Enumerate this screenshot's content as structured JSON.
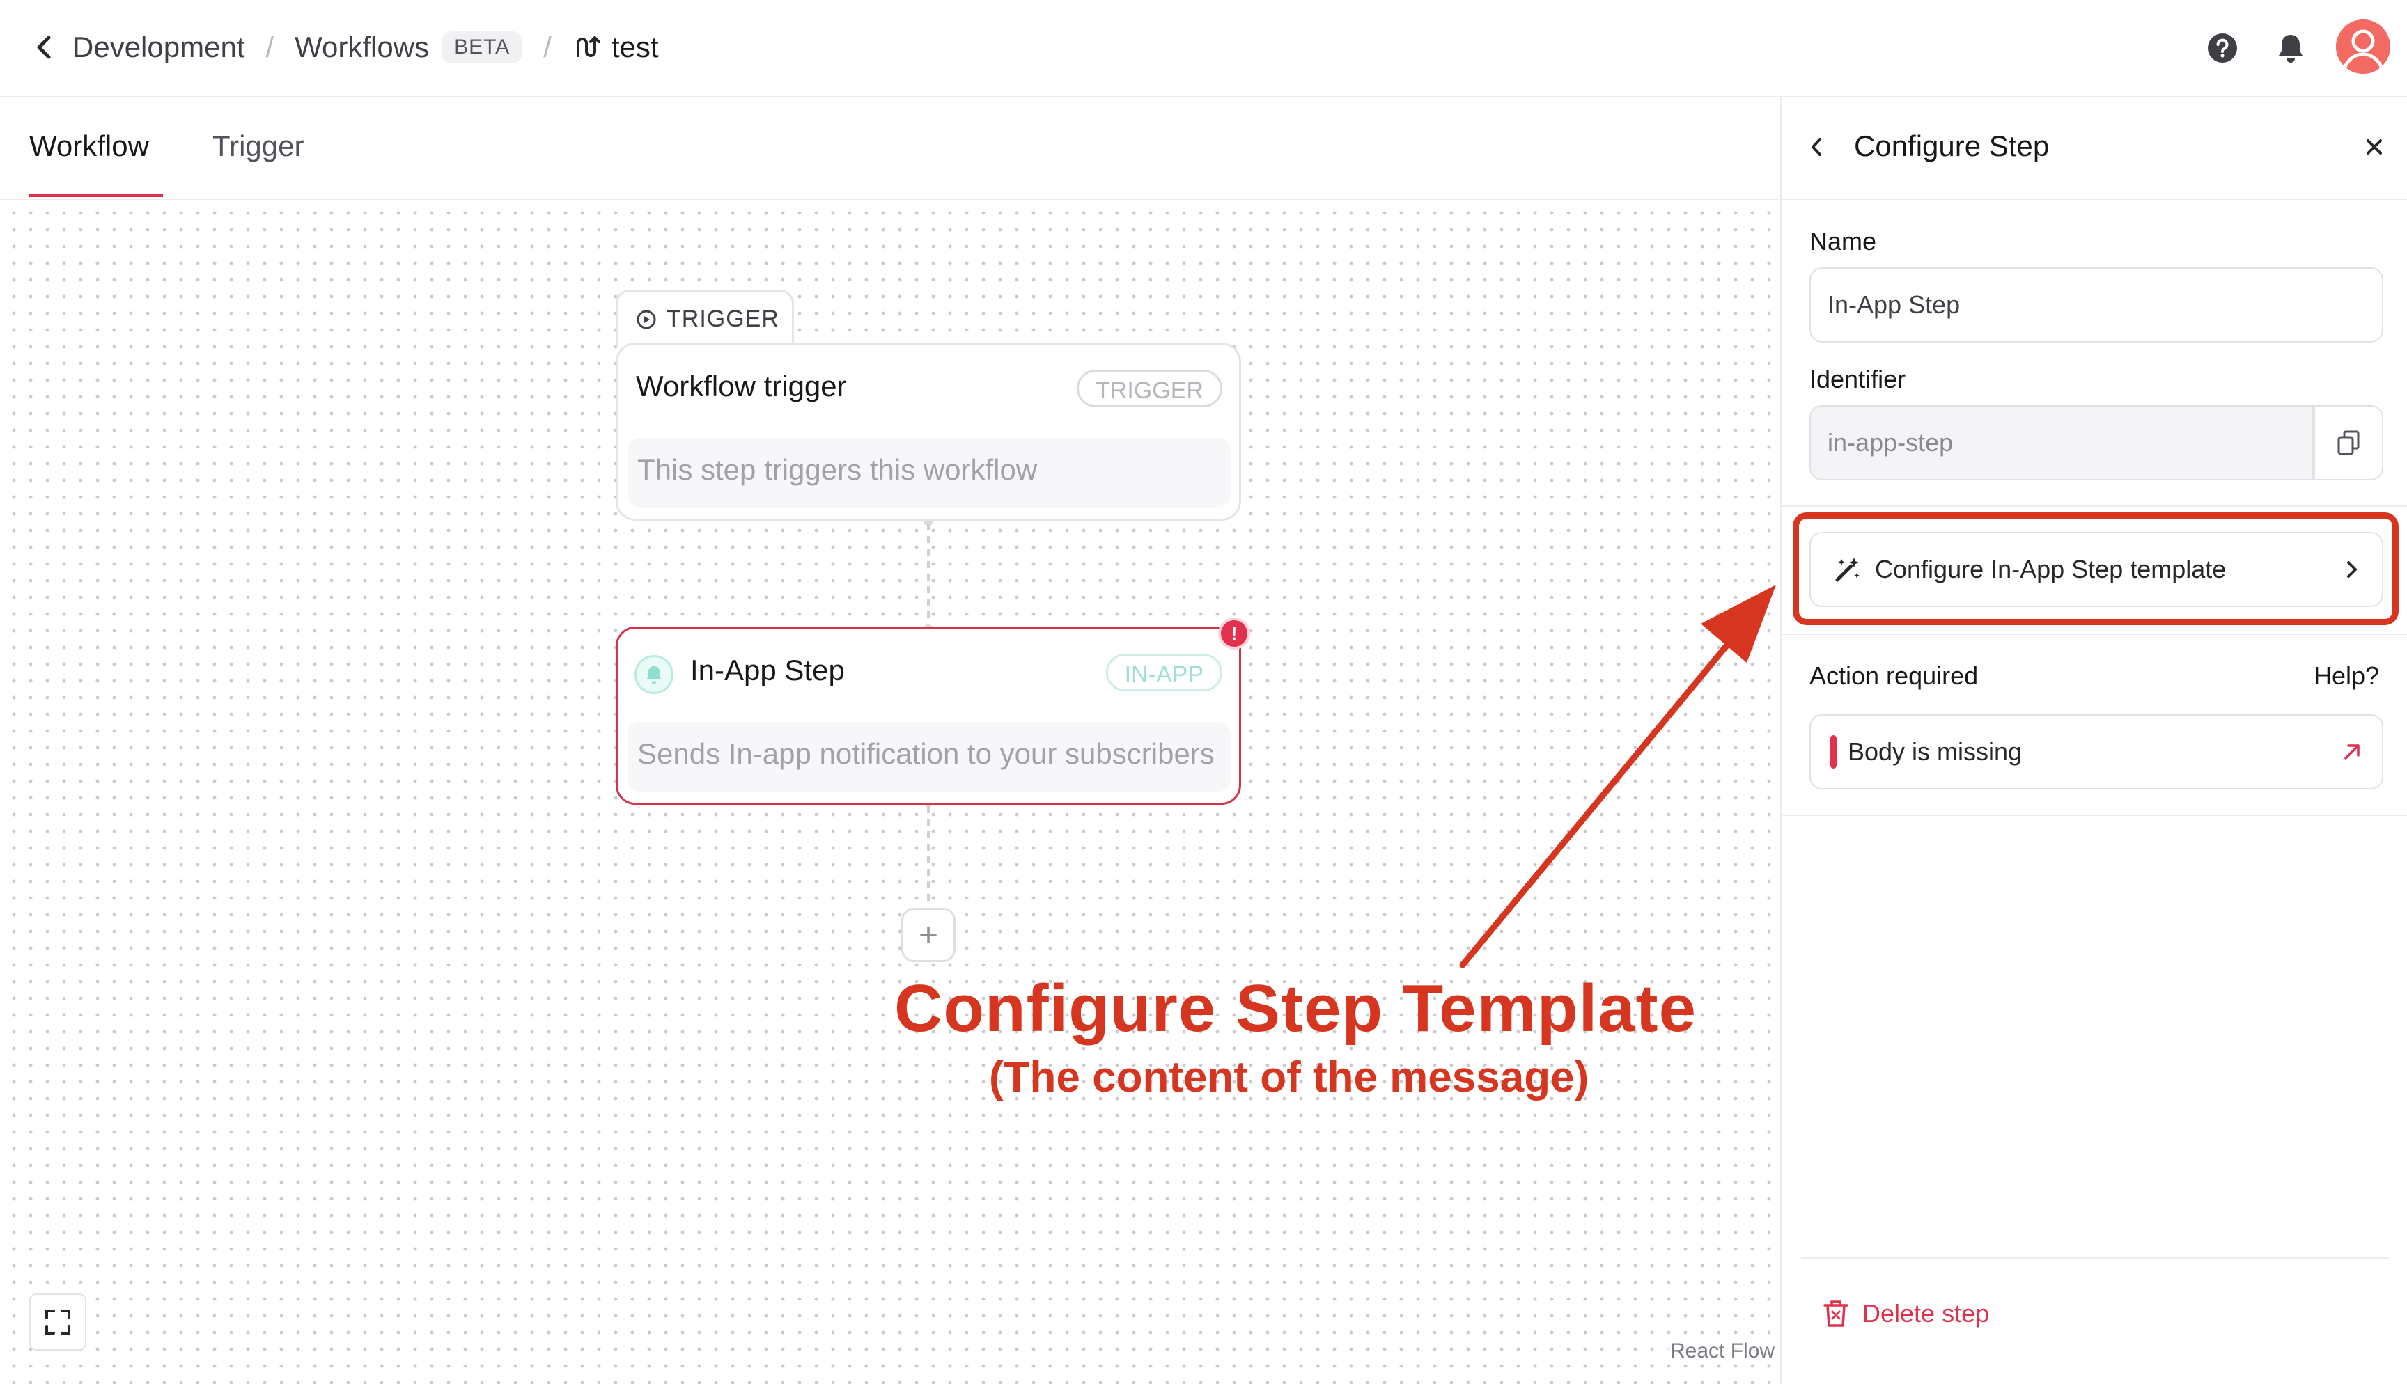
{
  "header": {
    "back_icon": "chevron-left-icon",
    "breadcrumbs": [
      "Development",
      "Workflows"
    ],
    "separator": "/",
    "beta_badge": "BETA",
    "workflow_name": "test",
    "workflow_icon": "workflow-icon",
    "help_icon": "help-circle-icon",
    "bell_icon": "bell-icon",
    "avatar_icon": "user-avatar"
  },
  "tabs": [
    {
      "label": "Workflow",
      "active": true
    },
    {
      "label": "Trigger",
      "active": false
    }
  ],
  "canvas": {
    "trigger_tab_label": "TRIGGER",
    "trigger_node": {
      "title": "Workflow trigger",
      "badge": "TRIGGER",
      "description": "This step triggers this workflow"
    },
    "inapp_node": {
      "title": "In-App Step",
      "badge": "IN-APP",
      "description": "Sends In-app notification to your subscribers",
      "error_indicator": "!"
    },
    "add_button": "+",
    "fit_view_icon": "fullscreen-icon",
    "attribution": "React Flow"
  },
  "annotation": {
    "title": "Configure Step Template",
    "subtitle": "(The content of the message)",
    "color": "#d6361f"
  },
  "panel": {
    "title": "Configure Step",
    "name_label": "Name",
    "name_value": "In-App Step",
    "identifier_label": "Identifier",
    "identifier_value": "in-app-step",
    "configure_button": "Configure In-App Step template",
    "action_required_label": "Action required",
    "help_link": "Help?",
    "issue": "Body is missing",
    "delete_label": "Delete step"
  },
  "colors": {
    "accent": "#e2314c",
    "annotation": "#d6361f",
    "inapp_badge": "#9ee0d1"
  }
}
